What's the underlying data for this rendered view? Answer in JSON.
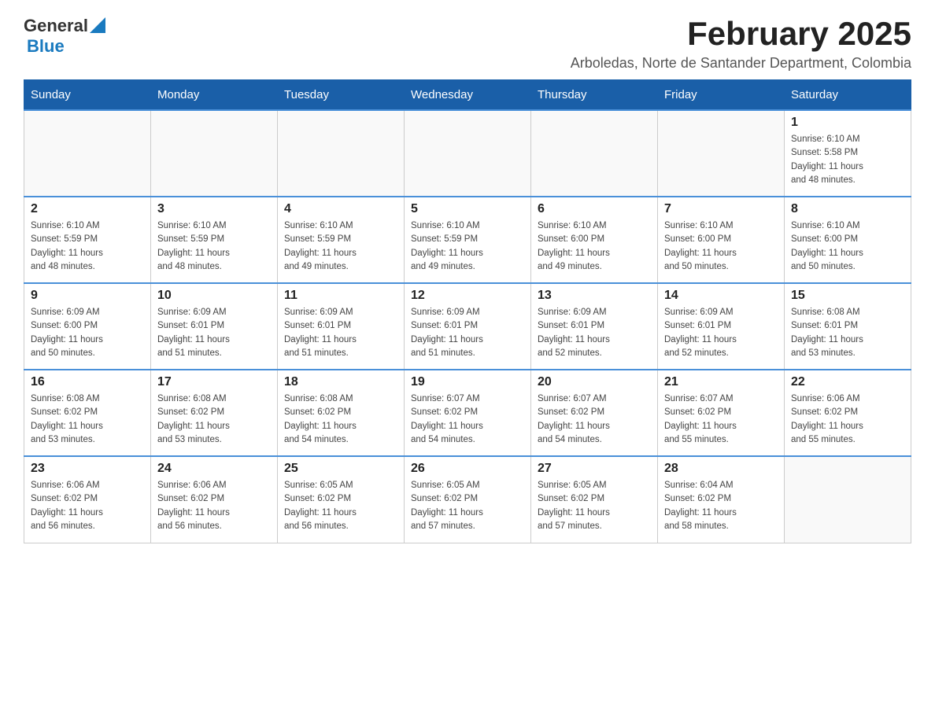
{
  "header": {
    "logo": {
      "general": "General",
      "blue": "Blue"
    },
    "title": "February 2025",
    "subtitle": "Arboledas, Norte de Santander Department, Colombia"
  },
  "days_of_week": [
    "Sunday",
    "Monday",
    "Tuesday",
    "Wednesday",
    "Thursday",
    "Friday",
    "Saturday"
  ],
  "weeks": [
    {
      "days": [
        {
          "number": "",
          "info": ""
        },
        {
          "number": "",
          "info": ""
        },
        {
          "number": "",
          "info": ""
        },
        {
          "number": "",
          "info": ""
        },
        {
          "number": "",
          "info": ""
        },
        {
          "number": "",
          "info": ""
        },
        {
          "number": "1",
          "info": "Sunrise: 6:10 AM\nSunset: 5:58 PM\nDaylight: 11 hours\nand 48 minutes."
        }
      ]
    },
    {
      "days": [
        {
          "number": "2",
          "info": "Sunrise: 6:10 AM\nSunset: 5:59 PM\nDaylight: 11 hours\nand 48 minutes."
        },
        {
          "number": "3",
          "info": "Sunrise: 6:10 AM\nSunset: 5:59 PM\nDaylight: 11 hours\nand 48 minutes."
        },
        {
          "number": "4",
          "info": "Sunrise: 6:10 AM\nSunset: 5:59 PM\nDaylight: 11 hours\nand 49 minutes."
        },
        {
          "number": "5",
          "info": "Sunrise: 6:10 AM\nSunset: 5:59 PM\nDaylight: 11 hours\nand 49 minutes."
        },
        {
          "number": "6",
          "info": "Sunrise: 6:10 AM\nSunset: 6:00 PM\nDaylight: 11 hours\nand 49 minutes."
        },
        {
          "number": "7",
          "info": "Sunrise: 6:10 AM\nSunset: 6:00 PM\nDaylight: 11 hours\nand 50 minutes."
        },
        {
          "number": "8",
          "info": "Sunrise: 6:10 AM\nSunset: 6:00 PM\nDaylight: 11 hours\nand 50 minutes."
        }
      ]
    },
    {
      "days": [
        {
          "number": "9",
          "info": "Sunrise: 6:09 AM\nSunset: 6:00 PM\nDaylight: 11 hours\nand 50 minutes."
        },
        {
          "number": "10",
          "info": "Sunrise: 6:09 AM\nSunset: 6:01 PM\nDaylight: 11 hours\nand 51 minutes."
        },
        {
          "number": "11",
          "info": "Sunrise: 6:09 AM\nSunset: 6:01 PM\nDaylight: 11 hours\nand 51 minutes."
        },
        {
          "number": "12",
          "info": "Sunrise: 6:09 AM\nSunset: 6:01 PM\nDaylight: 11 hours\nand 51 minutes."
        },
        {
          "number": "13",
          "info": "Sunrise: 6:09 AM\nSunset: 6:01 PM\nDaylight: 11 hours\nand 52 minutes."
        },
        {
          "number": "14",
          "info": "Sunrise: 6:09 AM\nSunset: 6:01 PM\nDaylight: 11 hours\nand 52 minutes."
        },
        {
          "number": "15",
          "info": "Sunrise: 6:08 AM\nSunset: 6:01 PM\nDaylight: 11 hours\nand 53 minutes."
        }
      ]
    },
    {
      "days": [
        {
          "number": "16",
          "info": "Sunrise: 6:08 AM\nSunset: 6:02 PM\nDaylight: 11 hours\nand 53 minutes."
        },
        {
          "number": "17",
          "info": "Sunrise: 6:08 AM\nSunset: 6:02 PM\nDaylight: 11 hours\nand 53 minutes."
        },
        {
          "number": "18",
          "info": "Sunrise: 6:08 AM\nSunset: 6:02 PM\nDaylight: 11 hours\nand 54 minutes."
        },
        {
          "number": "19",
          "info": "Sunrise: 6:07 AM\nSunset: 6:02 PM\nDaylight: 11 hours\nand 54 minutes."
        },
        {
          "number": "20",
          "info": "Sunrise: 6:07 AM\nSunset: 6:02 PM\nDaylight: 11 hours\nand 54 minutes."
        },
        {
          "number": "21",
          "info": "Sunrise: 6:07 AM\nSunset: 6:02 PM\nDaylight: 11 hours\nand 55 minutes."
        },
        {
          "number": "22",
          "info": "Sunrise: 6:06 AM\nSunset: 6:02 PM\nDaylight: 11 hours\nand 55 minutes."
        }
      ]
    },
    {
      "days": [
        {
          "number": "23",
          "info": "Sunrise: 6:06 AM\nSunset: 6:02 PM\nDaylight: 11 hours\nand 56 minutes."
        },
        {
          "number": "24",
          "info": "Sunrise: 6:06 AM\nSunset: 6:02 PM\nDaylight: 11 hours\nand 56 minutes."
        },
        {
          "number": "25",
          "info": "Sunrise: 6:05 AM\nSunset: 6:02 PM\nDaylight: 11 hours\nand 56 minutes."
        },
        {
          "number": "26",
          "info": "Sunrise: 6:05 AM\nSunset: 6:02 PM\nDaylight: 11 hours\nand 57 minutes."
        },
        {
          "number": "27",
          "info": "Sunrise: 6:05 AM\nSunset: 6:02 PM\nDaylight: 11 hours\nand 57 minutes."
        },
        {
          "number": "28",
          "info": "Sunrise: 6:04 AM\nSunset: 6:02 PM\nDaylight: 11 hours\nand 58 minutes."
        },
        {
          "number": "",
          "info": ""
        }
      ]
    }
  ]
}
